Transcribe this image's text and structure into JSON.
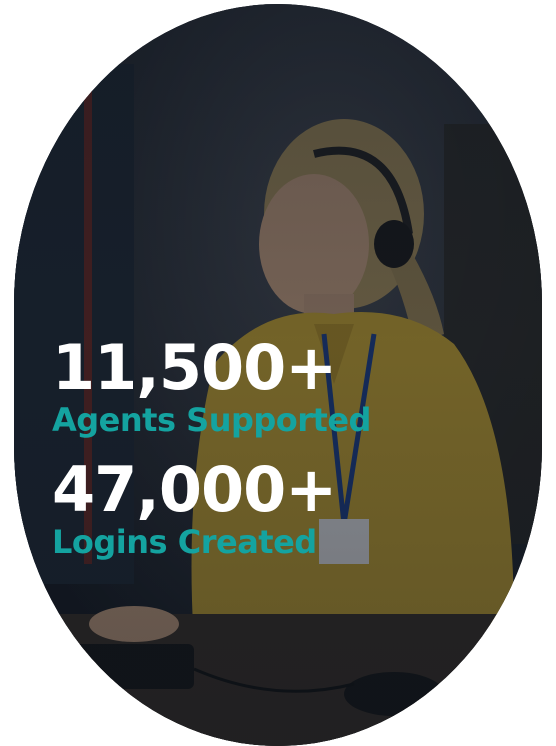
{
  "colors": {
    "accent": "#14a3a0",
    "value_text": "#ffffff"
  },
  "stats": [
    {
      "value": "11,500+",
      "label": "Agents Supported"
    },
    {
      "value": "47,000+",
      "label": "Logins Created"
    }
  ]
}
